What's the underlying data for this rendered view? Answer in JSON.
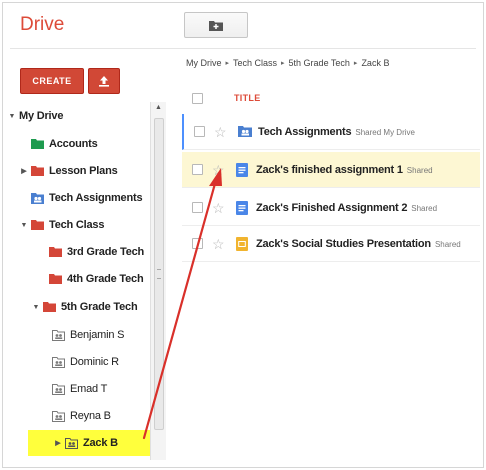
{
  "app": {
    "brand": "Drive"
  },
  "toolbar": {
    "new_folder_icon": "new-folder-icon",
    "create_label": "CREATE",
    "upload_icon": "upload-icon"
  },
  "breadcrumb": [
    "My Drive",
    "Tech Class",
    "5th Grade Tech",
    "Zack B"
  ],
  "list_header": {
    "title_label": "TITLE"
  },
  "sidebar": {
    "root": "My Drive",
    "items": [
      {
        "label": "Accounts",
        "icon": "folder-green-icon",
        "color": "#1e9b4f"
      },
      {
        "label": "Lesson Plans",
        "icon": "folder-red-icon",
        "color": "#d44638"
      },
      {
        "label": "Tech Assignments",
        "icon": "shared-folder-blue-icon",
        "color": "#4a7fd0"
      },
      {
        "label": "Tech Class",
        "icon": "folder-red-icon",
        "color": "#d44638"
      },
      {
        "label": "3rd Grade Tech",
        "icon": "folder-red-icon",
        "color": "#d44638"
      },
      {
        "label": "4th Grade Tech",
        "icon": "folder-red-icon",
        "color": "#d44638"
      },
      {
        "label": "5th Grade Tech",
        "icon": "folder-red-icon",
        "color": "#d44638"
      },
      {
        "label": "Benjamin S",
        "icon": "shared-folder-gray-icon",
        "color": "#8a8a8a"
      },
      {
        "label": "Dominic R",
        "icon": "shared-folder-gray-icon",
        "color": "#8a8a8a"
      },
      {
        "label": "Emad T",
        "icon": "shared-folder-gray-icon",
        "color": "#8a8a8a"
      },
      {
        "label": "Reyna B",
        "icon": "shared-folder-gray-icon",
        "color": "#8a8a8a"
      },
      {
        "label": "Zack B",
        "icon": "shared-folder-gray-icon",
        "color": "#8a8a8a",
        "selected": true
      }
    ]
  },
  "files": [
    {
      "name": "Tech Assignments",
      "meta": "Shared My Drive",
      "icon": "shared-folder-blue-icon",
      "color": "#4a7fd0"
    },
    {
      "name": "Zack's finished assignment 1",
      "meta": "Shared",
      "icon": "google-doc-icon",
      "color": "#4a86e8"
    },
    {
      "name": "Zack's Finished Assignment 2",
      "meta": "Shared",
      "icon": "google-doc-icon",
      "color": "#4a86e8"
    },
    {
      "name": "Zack's Social Studies Presentation",
      "meta": "Shared",
      "icon": "google-slides-icon",
      "color": "#f1b42f"
    }
  ],
  "colors": {
    "accent": "#dd4b39",
    "selection": "#ffff3c",
    "highlight_row": "#fdf7d3",
    "annotation_arrow": "#d9302a"
  }
}
